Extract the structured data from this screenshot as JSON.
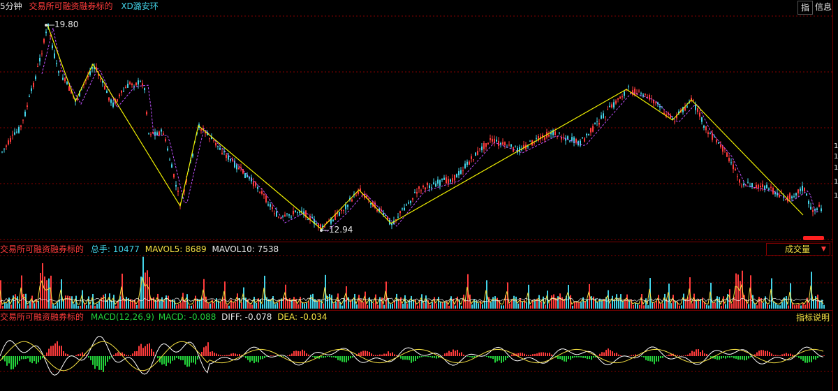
{
  "colors": {
    "background": "#000000",
    "up_candle": "#ff3b3b",
    "down_candle": "#43d3e8",
    "zigzag": "#f0f000",
    "grid": "#8a0000",
    "ma_line": "#c050ff"
  },
  "header": {
    "period": "5分钟",
    "stock_name": "交易所可融资融券标的",
    "indicator": "XD潞安环",
    "btn_zhi": "指",
    "btn_info": "信息"
  },
  "price_panel": {
    "high_label": "19.80",
    "low_label": "12.94",
    "right_ticks": [
      "1",
      "1",
      "1",
      "1",
      "1"
    ]
  },
  "volume_panel": {
    "stock_name": "交易所可融资融券标的",
    "total_label": "总手: ",
    "total_value": "10477",
    "mavol5_label": "MAVOL5: ",
    "mavol5_value": "8689",
    "mavol10_label": "MAVOL10: ",
    "mavol10_value": "7538",
    "dropdown": "成交量"
  },
  "macd_panel": {
    "stock_name": "交易所可融资融券标的",
    "macd_params": "MACD(12,26,9)",
    "macd_label": "MACD: ",
    "macd_value": "-0.088",
    "diff_label": "DIFF: ",
    "diff_value": "-0.078",
    "dea_label": "DEA: ",
    "dea_value": "-0.034",
    "explain_btn": "指标说明"
  },
  "chart_data": {
    "type": "candlestick",
    "zigzag": [
      19.8,
      16.9,
      18.1,
      13.9,
      16.4,
      12.94,
      14.4,
      13.2,
      17.7,
      16.9,
      17.4,
      13.6
    ],
    "price_ylim": [
      12.5,
      20.1
    ]
  }
}
